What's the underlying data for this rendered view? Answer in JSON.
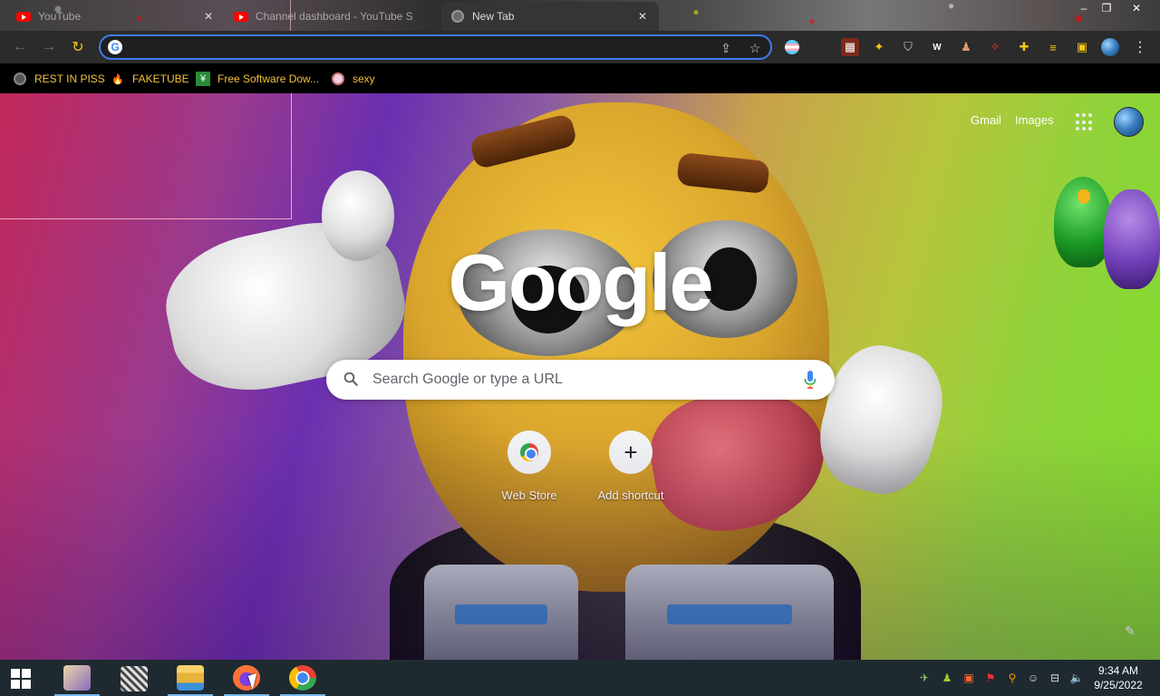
{
  "tabs": [
    {
      "title": "YouTube",
      "favicon": "youtube-icon"
    },
    {
      "title": "Channel dashboard - YouTube S",
      "favicon": "youtube-icon"
    },
    {
      "title": "New Tab",
      "favicon": "globe-icon",
      "active": true
    }
  ],
  "window_controls": {
    "minimize": "‒",
    "restore": "❐",
    "close": "✕"
  },
  "toolbar": {
    "back": "←",
    "forward": "→",
    "reload": "↻",
    "address_value": "",
    "share_icon": "share-icon",
    "star_icon": "star-icon",
    "menu": "⋮"
  },
  "bookmarks": [
    {
      "label": "REST IN PISS",
      "icon": "globe-icon"
    },
    {
      "label": "FAKETUBE",
      "icon": "fire-icon"
    },
    {
      "label": "Free Software Dow...",
      "icon": "download-icon"
    },
    {
      "label": "sexy",
      "icon": "heart-icon"
    }
  ],
  "google": {
    "gmail": "Gmail",
    "images": "Images",
    "logo": "Google",
    "search_placeholder": "Search Google or type a URL",
    "shortcuts": [
      {
        "label": "Web Store"
      },
      {
        "label": "Add shortcut",
        "glyph": "+"
      }
    ]
  },
  "taskbar": {
    "time": "9:34 AM",
    "date": "9/25/2022"
  },
  "colors": {
    "accent": "#3d7df0",
    "bookmark_text": "#f3c23b",
    "reload": "#f5c518"
  }
}
